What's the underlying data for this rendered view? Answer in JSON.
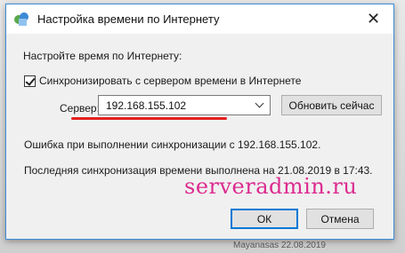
{
  "window": {
    "title": "Настройка времени по Интернету",
    "close_glyph": "✕"
  },
  "main": {
    "instruction": "Настройте время по Интернету:",
    "sync_checkbox": {
      "label": "Синхронизировать с сервером времени в Интернете",
      "checked": true
    },
    "server_label": "Сервер:",
    "server_value": "192.168.155.102",
    "update_button": "Обновить сейчас",
    "error_message": "Ошибка при выполнении синхронизации с 192.168.155.102.",
    "last_sync_message": "Последняя синхронизация времени выполнена на 21.08.2019 в 17:43."
  },
  "footer": {
    "ok_label": "ОК",
    "cancel_label": "Отмена"
  },
  "overlay": {
    "watermark": "serveradmin.ru",
    "watermark_color": "#dd2a8f",
    "annotation_color": "#e32020"
  },
  "background": {
    "partial_text": "Mayanasas 22.08.2019"
  },
  "icons": {
    "app": "internet-time-icon",
    "close": "close-icon",
    "dropdown": "chevron-down-icon",
    "check": "checkmark-icon"
  }
}
